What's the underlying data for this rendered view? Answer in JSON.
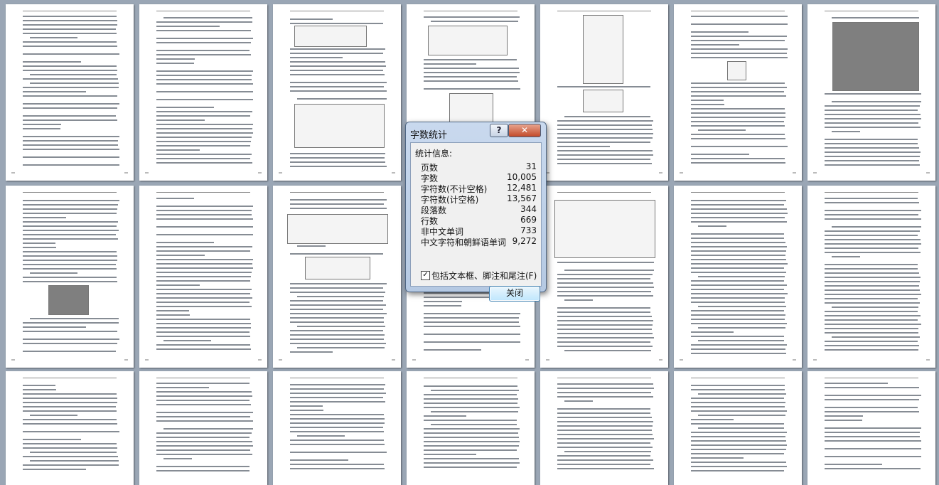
{
  "dialog": {
    "title": "字数统计",
    "help_label": "?",
    "close_icon": "✕",
    "section_label": "统计信息:",
    "stats": [
      {
        "label": "页数",
        "value": "31"
      },
      {
        "label": "字数",
        "value": "10,005"
      },
      {
        "label": "字符数(不计空格)",
        "value": "12,481"
      },
      {
        "label": "字符数(计空格)",
        "value": "13,567"
      },
      {
        "label": "段落数",
        "value": "344"
      },
      {
        "label": "行数",
        "value": "669"
      },
      {
        "label": "非中文单词",
        "value": "733"
      },
      {
        "label": "中文字符和朝鲜语单词",
        "value": "9,272"
      }
    ],
    "include_checkbox": {
      "checked": true,
      "mark": "✓",
      "label": "包括文本框、脚注和尾注(F)"
    },
    "close_button_label": "关闭"
  },
  "document_preview": {
    "page_rows": 3,
    "pages_per_row": 7
  }
}
